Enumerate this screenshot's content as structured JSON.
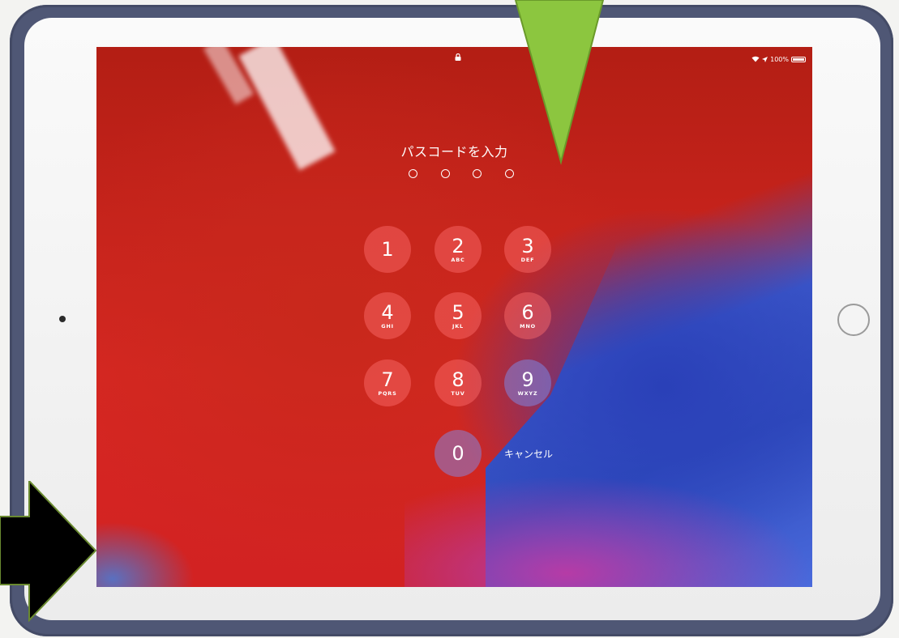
{
  "screen": {
    "status": {
      "lock_icon": "lock-icon",
      "wifi_icon": "wifi-icon",
      "location_icon": "location-arrow-icon",
      "battery_text": "100%",
      "battery_icon": "battery-icon"
    },
    "passcode": {
      "title": "パスコードを入力",
      "dots_count_entered": 0
    },
    "keypad": [
      {
        "num": "1",
        "letters": ""
      },
      {
        "num": "2",
        "letters": "ABC"
      },
      {
        "num": "3",
        "letters": "DEF"
      },
      {
        "num": "4",
        "letters": "GHI"
      },
      {
        "num": "5",
        "letters": "JKL"
      },
      {
        "num": "6",
        "letters": "MNO"
      },
      {
        "num": "7",
        "letters": "PQRS"
      },
      {
        "num": "8",
        "letters": "TUV"
      },
      {
        "num": "9",
        "letters": "WXYZ"
      },
      {
        "num": "0",
        "letters": ""
      }
    ],
    "cancel_label": "キャンセル"
  },
  "annotations": {
    "green_arrow_color": "#8cc63f",
    "black_arrow_color": "#000000"
  },
  "colors": {
    "case": "#4f5775",
    "bezel": "#f5f5f5",
    "wallpaper_red": "#d22222",
    "wallpaper_blue": "#2f4bbd"
  }
}
